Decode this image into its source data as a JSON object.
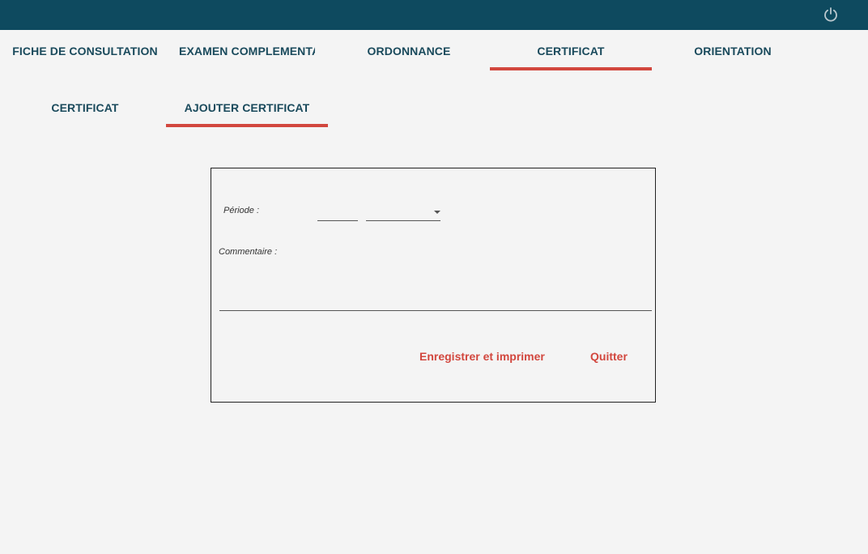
{
  "topbar": {
    "power_icon": "power-icon",
    "color": "#0e4a5f"
  },
  "main_tabs": [
    {
      "label": "FICHE DE CONSULTATION"
    },
    {
      "label": "EXAMEN COMPLEMENTAIRE"
    },
    {
      "label": "ORDONNANCE"
    },
    {
      "label": "CERTIFICAT",
      "active": true
    },
    {
      "label": "ORIENTATION"
    }
  ],
  "sub_tabs": [
    {
      "label": "CERTIFICAT"
    },
    {
      "label": "AJOUTER CERTIFICAT",
      "active": true
    }
  ],
  "form": {
    "periode_label": "Période :",
    "periode_value": "",
    "periode_unit": "",
    "commentaire_label": "Commentaire :",
    "commentaire_value": "",
    "save_print_label": "Enregistrer et imprimer",
    "quit_label": "Quitter"
  },
  "colors": {
    "accent": "#d2473e",
    "tab_text": "#1a4a5c",
    "background": "#f4f4f4"
  }
}
